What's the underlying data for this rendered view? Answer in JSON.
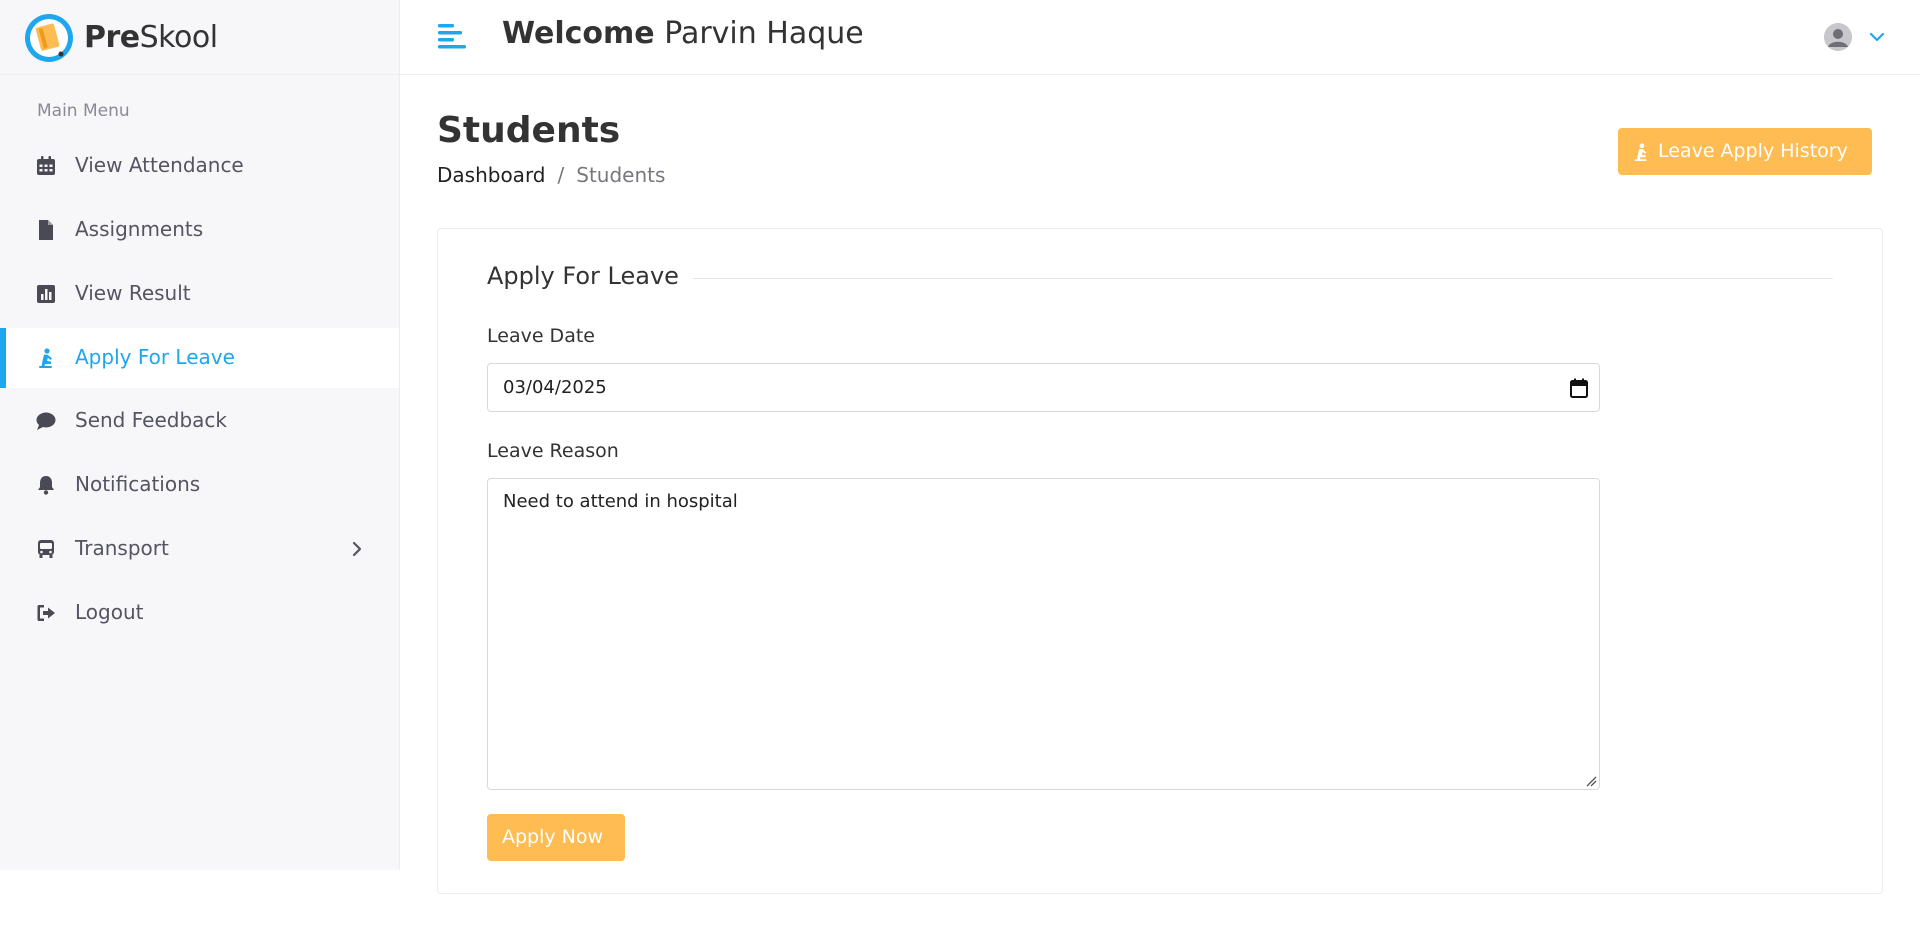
{
  "brand": {
    "name_bold": "Pre",
    "name_rest": "Skool",
    "accent": "#1ea7ee",
    "button_color": "#ffbc53"
  },
  "header": {
    "toggle_icon": "menu-lines-icon",
    "welcome_word": "Welcome",
    "user_name": "Parvin Haque",
    "avatar_icon": "user-avatar-icon",
    "dropdown_icon": "chevron-down-icon"
  },
  "sidebar": {
    "menu_title": "Main Menu",
    "items": [
      {
        "label": "View Attendance",
        "icon": "calendar-icon"
      },
      {
        "label": "Assignments",
        "icon": "file-icon"
      },
      {
        "label": "View Result",
        "icon": "bar-chart-icon"
      },
      {
        "label": "Apply For Leave",
        "icon": "person-kneel-icon",
        "active": true
      },
      {
        "label": "Send Feedback",
        "icon": "comment-icon"
      },
      {
        "label": "Notifications",
        "icon": "bell-icon"
      },
      {
        "label": "Transport",
        "icon": "bus-icon",
        "has_submenu": true
      },
      {
        "label": "Logout",
        "icon": "sign-out-icon"
      }
    ]
  },
  "page": {
    "title": "Students",
    "breadcrumb": {
      "parent": "Dashboard",
      "separator": "/",
      "current": "Students"
    },
    "history_button": "Leave Apply History"
  },
  "form": {
    "legend": "Apply For Leave",
    "date_label": "Leave Date",
    "date_value": "03/04/2025",
    "reason_label": "Leave Reason",
    "reason_value": "Need to attend in hospital",
    "submit_label": "Apply Now"
  }
}
